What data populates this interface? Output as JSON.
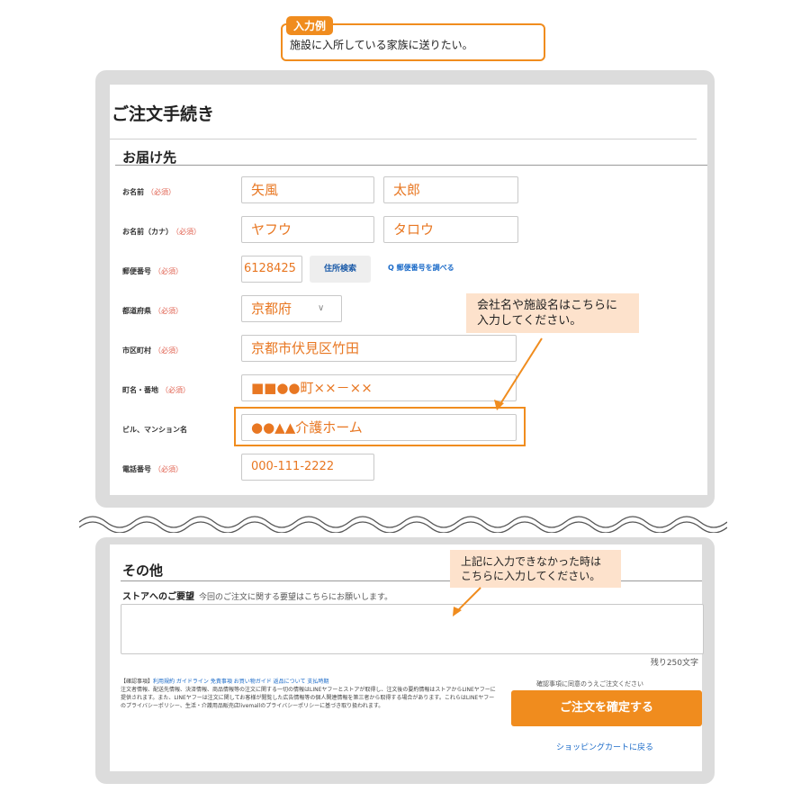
{
  "example": {
    "badge": "入力例",
    "text": "施設に入所している家族に送りたい。"
  },
  "order": {
    "title": "ご注文手続き",
    "delivery_section": "お届け先",
    "required": "（必須）",
    "fields": {
      "name_label": "お名前",
      "last_name": "矢風",
      "first_name": "太郎",
      "kana_label": "お名前（カナ）",
      "last_kana": "ヤフウ",
      "first_kana": "タロウ",
      "zip_label": "郵便番号",
      "zip": "6128425",
      "zip_search_button": "住所検索",
      "zip_lookup_link": "Q 郵便番号を調べる",
      "pref_label": "都道府県",
      "pref": "京都府",
      "city_label": "市区町村",
      "city": "京都市伏見区竹田",
      "street_label": "町名・番地",
      "street": "■■●●町××－××",
      "building_label": "ビル、マンション名",
      "building": "●●▲▲介護ホーム",
      "phone_label": "電話番号",
      "phone": "000-111-2222"
    },
    "note_building": "会社名や施設名はこちらに\n入力してください。"
  },
  "other": {
    "section": "その他",
    "request_label": "ストアへのご要望",
    "request_desc": "今回のご注文に関する要望はこちらにお願いします。",
    "note": "上記に入力できなかった時は\nこちらに入力してください。",
    "remaining": "残り250文字",
    "confirm_prefix": "【確認事項】",
    "confirm_links": "利用規約 ガイドライン 免責事項 お買い物ガイド 返品について 支払時期",
    "confirm_body": "注文者情報、配送先情報、決済情報、商品情報等の注文に関する一切の情報はLINEヤフーとストアが取得し、注文後の要約情報はストアからLINEヤフーに提供されます。また、LINEヤフーは注文に関してお客様が閲覧した広告情報等の個人関連情報を第三者から取得する場合があります。これらはLINEヤフーのプライバシーポリシー、生活・介護用品販売店livemallのプライバシーポリシーに基づき取り扱われます。",
    "agree_text": "確認事項に同意のうえご注文ください",
    "order_button": "ご注文を確定する",
    "back_link": "ショッピングカートに戻る"
  },
  "colors": {
    "accent": "#f08c1e",
    "input_text": "#e87722",
    "note_bg": "#fde2cc",
    "link": "#1a6ac8",
    "panel_bg": "#dcdcdc"
  }
}
